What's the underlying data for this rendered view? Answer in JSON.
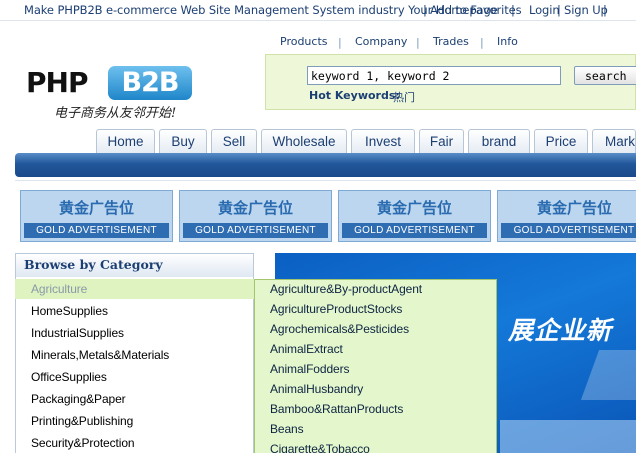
{
  "topbar": {
    "tagline": "Make PHPB2B e-commerce Web Site Management System industry Your Homepage",
    "favorites": "Add to Favorites",
    "login": "Login",
    "signup": "Sign Up",
    "sep": "|"
  },
  "logo": {
    "php": "PHP",
    "b2b": "B2B",
    "slogan": "电子商务从友邻开始!"
  },
  "search": {
    "tabs": [
      "Products",
      "Company",
      "Trades",
      "Info"
    ],
    "tab_sep": "|",
    "input_value": "keyword 1, keyword 2",
    "button_label": "search",
    "hot_label": "Hot Keywords:",
    "hot_value": "热门"
  },
  "nav": {
    "items": [
      "Home",
      "Buy",
      "Sell",
      "Wholesale",
      "Invest",
      "Fair",
      "brand",
      "Price",
      "Marke"
    ]
  },
  "ads": [
    {
      "cn": "黄金广告位",
      "en": "GOLD   ADVERTISEMENT"
    },
    {
      "cn": "黄金广告位",
      "en": "GOLD   ADVERTISEMENT"
    },
    {
      "cn": "黄金广告位",
      "en": "GOLD   ADVERTISEMENT"
    },
    {
      "cn": "黄金广告位",
      "en": "GOLD   ADVERTISEMENT"
    }
  ],
  "categories": {
    "title": "Browse by Category",
    "items": [
      "Agriculture",
      "HomeSupplies",
      "IndustrialSupplies",
      "Minerals,Metals&Materials",
      "OfficeSupplies",
      "Packaging&Paper",
      "Printing&Publishing",
      "Security&Protection"
    ]
  },
  "submenu": {
    "items": [
      "Agriculture&By-productAgent",
      "AgricultureProductStocks",
      "Agrochemicals&Pesticides",
      "AnimalExtract",
      "AnimalFodders",
      "AnimalHusbandry",
      "Bamboo&RattanProducts",
      "Beans",
      "Cigarette&Tobacco"
    ]
  },
  "banner": {
    "text": "展企业新"
  },
  "colors": {
    "link": "#1c3f73",
    "nav_bar": "#21579b",
    "search_panel": "#eef8d8",
    "submenu_bg": "#e3f6cc",
    "ad_bg": "#bcd6ef",
    "banner_blue": "#1479d9"
  }
}
